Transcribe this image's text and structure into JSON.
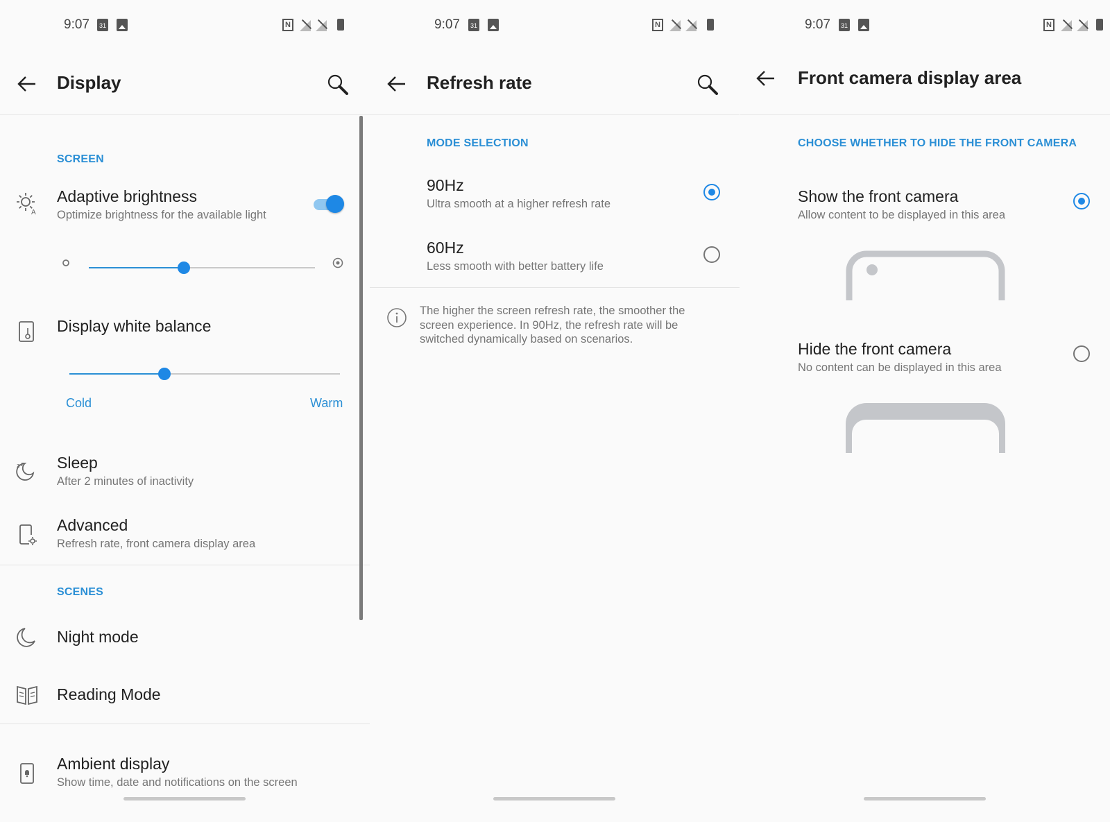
{
  "status_bar": {
    "time": "9:07",
    "calendar_day": "31",
    "nfc_label": "N"
  },
  "display": {
    "title": "Display",
    "screen_header": "SCREEN",
    "adaptive_brightness": {
      "title": "Adaptive brightness",
      "subtitle": "Optimize brightness for the available light",
      "enabled": true
    },
    "brightness_level": 0.42,
    "white_balance": {
      "title": "Display white balance",
      "cold_label": "Cold",
      "warm_label": "Warm",
      "level": 0.35
    },
    "sleep": {
      "title": "Sleep",
      "subtitle": "After 2 minutes of inactivity"
    },
    "advanced": {
      "title": "Advanced",
      "subtitle": "Refresh rate, front camera display area"
    },
    "scenes_header": "SCENES",
    "night_mode": {
      "title": "Night mode"
    },
    "reading_mode": {
      "title": "Reading Mode"
    },
    "ambient_display": {
      "title": "Ambient display",
      "subtitle": "Show time, date and notifications on the screen"
    }
  },
  "refresh_rate": {
    "title": "Refresh rate",
    "section_header": "MODE SELECTION",
    "options": [
      {
        "title": "90Hz",
        "subtitle": "Ultra smooth at a higher refresh rate",
        "selected": true
      },
      {
        "title": "60Hz",
        "subtitle": "Less smooth with better battery life",
        "selected": false
      }
    ],
    "info_lines": [
      "The higher the screen refresh rate, the smoother the",
      "screen experience. In 90Hz, the refresh rate will be",
      "switched dynamically based on scenarios."
    ]
  },
  "front_camera": {
    "title": "Front camera display area",
    "section_header": "CHOOSE WHETHER TO HIDE THE FRONT CAMERA",
    "options": [
      {
        "title": "Show the front camera",
        "subtitle": "Allow content to be displayed in this area",
        "selected": true
      },
      {
        "title": "Hide the front camera",
        "subtitle": "No content can be displayed in this area",
        "selected": false
      }
    ]
  },
  "colors": {
    "accent": "#1e88e5",
    "header_blue": "#2b8fd5",
    "illustration_gray": "#c4c6ca"
  }
}
